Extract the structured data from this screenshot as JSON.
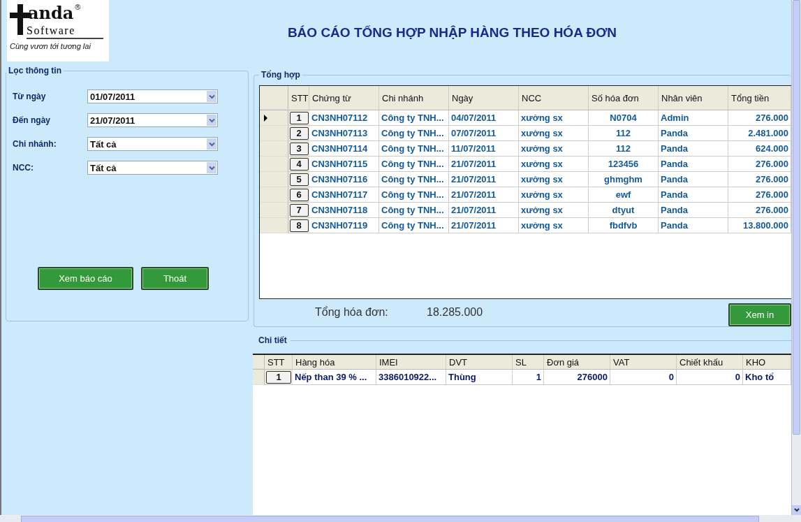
{
  "logo": {
    "brand": "anda",
    "subtitle": "Software",
    "trademark": "®",
    "slogan": "Cùng vươn tới tương lai"
  },
  "title": "BÁO CÁO TỔNG HỢP NHẬP HÀNG THEO HÓA ĐƠN",
  "filter": {
    "title": "Lọc thông tin",
    "fields": [
      {
        "label": "Từ ngày",
        "value": "01/07/2011"
      },
      {
        "label": "Đến ngày",
        "value": "21/07/2011"
      },
      {
        "label": "Chi nhánh:",
        "value": "Tất cả"
      },
      {
        "label": "NCC:",
        "value": "Tất cả"
      }
    ],
    "buttons": [
      "Xem báo cáo",
      "Thoát"
    ]
  },
  "summary": {
    "title": "Tổng hợp",
    "columns": [
      "STT",
      "Chứng từ",
      "Chi nhánh",
      "Ngày",
      "NCC",
      "Số hóa đơn",
      "Nhân viên",
      "Tổng tiền"
    ],
    "rows": [
      {
        "selected": true,
        "cells": [
          "1",
          "CN3NH07112",
          "Công ty TNH...",
          "04/07/2011",
          "xưởng sx",
          "N0704",
          "Admin",
          "276.000"
        ]
      },
      {
        "selected": false,
        "cells": [
          "2",
          "CN3NH07113",
          "Công ty TNH...",
          "07/07/2011",
          "xưởng sx",
          "112",
          "Panda",
          "2.481.000"
        ]
      },
      {
        "selected": false,
        "cells": [
          "3",
          "CN3NH07114",
          "Công ty TNH...",
          "11/07/2011",
          "xưởng sx",
          "112",
          "Panda",
          "624.000"
        ]
      },
      {
        "selected": false,
        "cells": [
          "4",
          "CN3NH07115",
          "Công ty TNH...",
          "21/07/2011",
          "xưởng sx",
          "123456",
          "Panda",
          "276.000"
        ]
      },
      {
        "selected": false,
        "cells": [
          "5",
          "CN3NH07116",
          "Công ty TNH...",
          "21/07/2011",
          "xưởng sx",
          "ghmghm",
          "Panda",
          "276.000"
        ]
      },
      {
        "selected": false,
        "cells": [
          "6",
          "CN3NH07117",
          "Công ty TNH...",
          "21/07/2011",
          "xưởng sx",
          "ewf",
          "Panda",
          "276.000"
        ]
      },
      {
        "selected": false,
        "cells": [
          "7",
          "CN3NH07118",
          "Công ty TNH...",
          "21/07/2011",
          "xưởng sx",
          "dtyut",
          "Panda",
          "276.000"
        ]
      },
      {
        "selected": false,
        "cells": [
          "8",
          "CN3NH07119",
          "Công ty TNH...",
          "21/07/2011",
          "xưởng sx",
          "fbdfvb",
          "Panda",
          "13.800.000"
        ]
      }
    ],
    "total_label": "Tổng hóa đơn:",
    "total_value": "18.285.000",
    "print_button": "Xem in"
  },
  "detail": {
    "title": "Chi tiết",
    "columns": [
      "STT",
      "Hàng hóa",
      "IMEI",
      "DVT",
      "SL",
      "Đơn giá",
      "VAT",
      "Chiết khấu",
      "KHO"
    ],
    "rows": [
      {
        "cells": [
          "1",
          "Nếp than 39 % ...",
          "3386010922...",
          "Thùng",
          "1",
          "276000",
          "0",
          "0",
          "Kho tổ"
        ]
      }
    ]
  }
}
